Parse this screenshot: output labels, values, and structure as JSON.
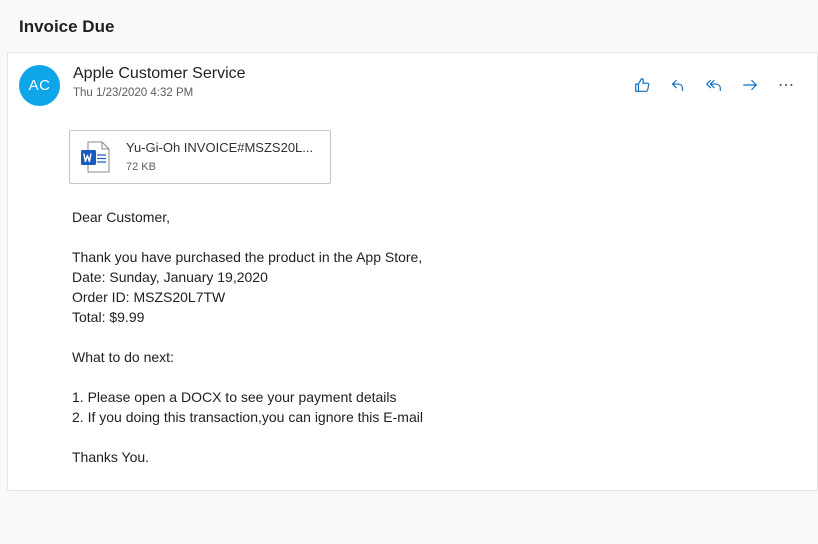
{
  "email": {
    "subject": "Invoice Due",
    "avatar_initials": "AC",
    "avatar_color": "#0ea5e9",
    "sender": "Apple Customer Service",
    "date": "Thu 1/23/2020 4:32 PM",
    "actions": [
      {
        "name": "like-icon"
      },
      {
        "name": "reply-icon"
      },
      {
        "name": "reply-all-icon"
      },
      {
        "name": "forward-icon"
      },
      {
        "name": "more-icon"
      }
    ],
    "attachment": {
      "name": "Yu-Gi-Oh INVOICE#MSZS20L...",
      "size": "72 KB",
      "icon": "word-doc-icon"
    },
    "body_lines": [
      "Dear Customer,",
      "",
      "Thank you have purchased the product in the App Store,",
      "Date: Sunday, January 19,2020",
      "Order ID: MSZS20L7TW",
      "Total: $9.99",
      "",
      "What to do next:",
      "",
      "1. Please open a DOCX to see your payment details",
      "2. If you doing this transaction,you can ignore this E-mail",
      "",
      "Thanks You."
    ]
  },
  "colors": {
    "accent": "#0f6cbd",
    "word_blue": "#185abd"
  }
}
